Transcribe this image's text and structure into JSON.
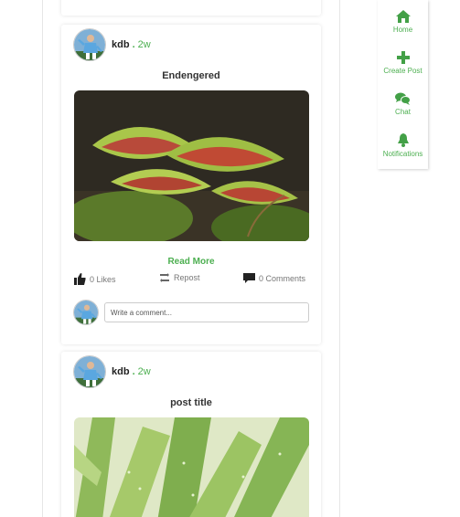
{
  "colors": {
    "accent": "#4caf50",
    "icon_green": "#43a047",
    "text_dark": "#222222",
    "muted": "#777777"
  },
  "posts": [
    {
      "author": "kdb",
      "separator": ".",
      "time": "2w",
      "title": "Endengered",
      "read_more": "Read More",
      "likes_label": "0 Likes",
      "repost_label": "Repost",
      "comments_label": "0 Comments",
      "comment_placeholder": "Write a comment..."
    },
    {
      "author": "kdb",
      "separator": ".",
      "time": "2w",
      "title": "post title"
    }
  ],
  "sidenav": {
    "items": [
      {
        "label": "Home",
        "icon": "home-icon"
      },
      {
        "label": "Create Post",
        "icon": "plus-icon"
      },
      {
        "label": "Chat",
        "icon": "chat-icon"
      },
      {
        "label": "Notifications",
        "icon": "bell-icon"
      }
    ]
  }
}
